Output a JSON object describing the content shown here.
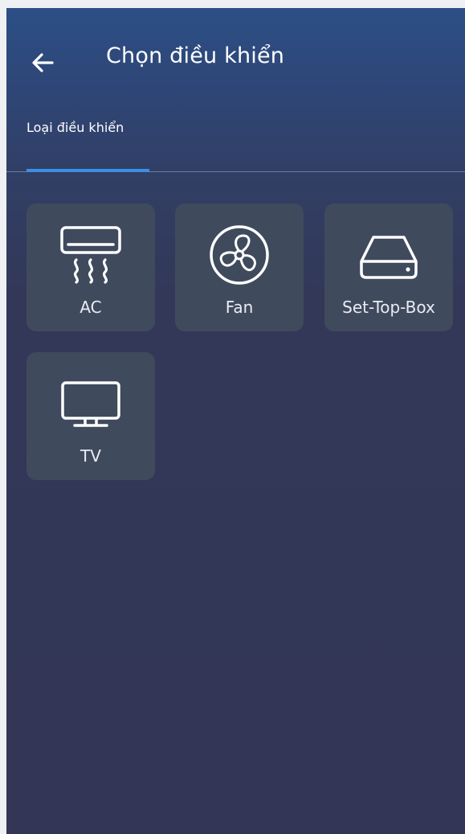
{
  "header": {
    "title": "Chọn điều khiển",
    "back_icon": "arrow-left-icon"
  },
  "tabs": [
    {
      "label": "Loại điều khiển",
      "active": true
    }
  ],
  "devices": [
    {
      "label": "AC",
      "icon": "air-conditioner-icon"
    },
    {
      "label": "Fan",
      "icon": "fan-icon"
    },
    {
      "label": "Set-Top-Box",
      "icon": "set-top-box-icon"
    },
    {
      "label": "TV",
      "icon": "tv-icon"
    }
  ],
  "colors": {
    "accent": "#3d8fe6",
    "tile_background": "#3f4a5d",
    "page_background": "#333656",
    "header_background": "#2c4f86"
  }
}
